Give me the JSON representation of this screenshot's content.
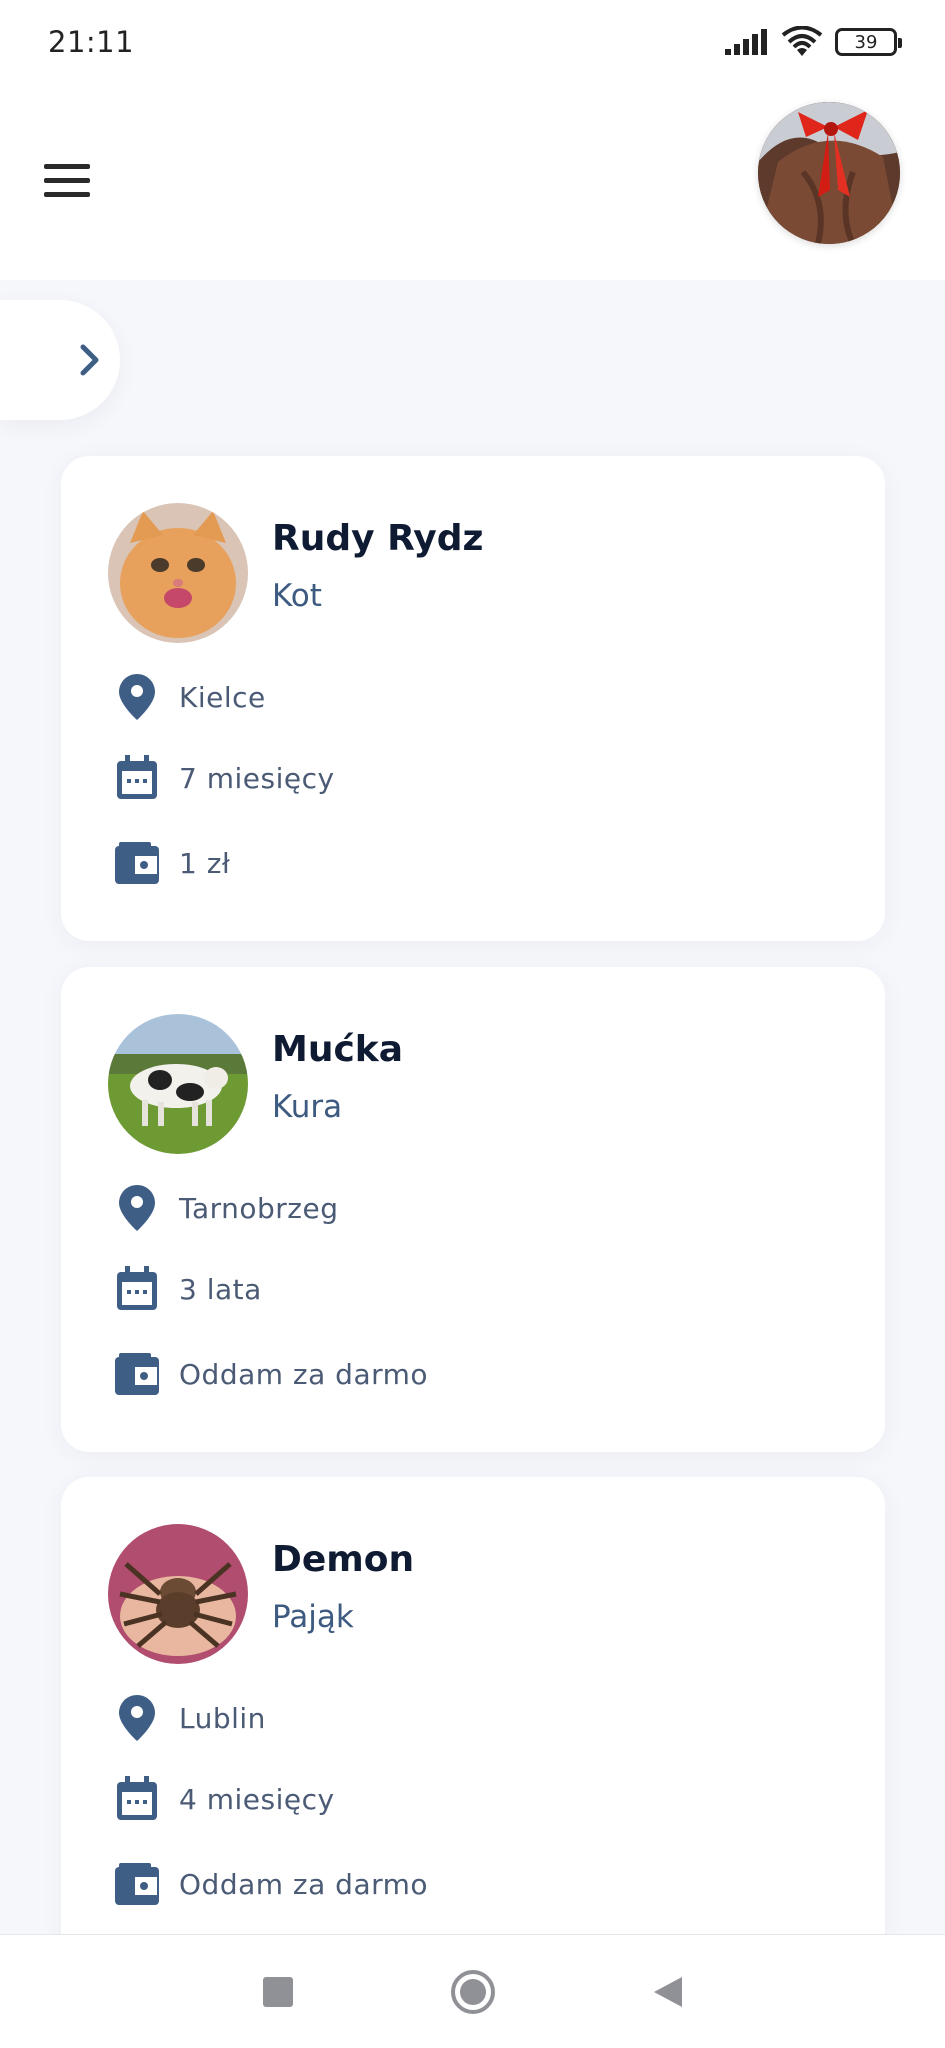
{
  "status_bar": {
    "time": "21:11",
    "battery": "39"
  },
  "colors": {
    "accent": "#3d5a80",
    "title": "#0f1a33",
    "icon": "#3f5e86",
    "background": "#f6f7fb",
    "card": "#ffffff"
  },
  "header": {
    "menu_icon": "hamburger-menu-icon",
    "avatar_icon": "user-avatar"
  },
  "side_tab": {
    "icon": "chevron-right-icon"
  },
  "pets": [
    {
      "name": "Rudy Rydz",
      "species": "Kot",
      "location": "Kielce",
      "age": "7 miesięcy",
      "price": "1 zł"
    },
    {
      "name": "Mućka",
      "species": "Kura",
      "location": "Tarnobrzeg",
      "age": "3 lata",
      "price": "Oddam za darmo"
    },
    {
      "name": "Demon",
      "species": "Pająk",
      "location": "Lublin",
      "age": "4 miesięcy",
      "price": "Oddam za darmo"
    }
  ],
  "nav_bar": {
    "buttons": [
      "recent-apps-square-icon",
      "home-circle-icon",
      "back-triangle-icon"
    ]
  }
}
